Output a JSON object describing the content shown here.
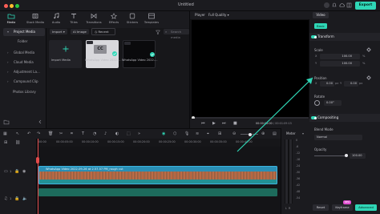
{
  "window": {
    "title": "Untitled",
    "export_label": "Export"
  },
  "toolbar": {
    "items": [
      {
        "label": "Media",
        "icon": "folder-icon"
      },
      {
        "label": "Stock Media",
        "icon": "stock-icon"
      },
      {
        "label": "Audio",
        "icon": "music-icon"
      },
      {
        "label": "Titles",
        "icon": "text-icon"
      },
      {
        "label": "Transitions",
        "icon": "transition-icon"
      },
      {
        "label": "Effects",
        "icon": "effects-icon"
      },
      {
        "label": "Stickers",
        "icon": "sticker-icon"
      },
      {
        "label": "Templates",
        "icon": "template-icon"
      }
    ]
  },
  "sidebar": {
    "items": [
      {
        "label": "Project Media"
      },
      {
        "label": "Folder"
      },
      {
        "label": "Global Media"
      },
      {
        "label": "Cloud Media"
      },
      {
        "label": "Adjustment La..."
      },
      {
        "label": "Compound Clip"
      },
      {
        "label": "Photos Library"
      }
    ]
  },
  "media": {
    "import_label": "Import",
    "ai_image_label": "AI Image",
    "recent_label": "Recent",
    "search_placeholder": "Search media",
    "import_tile_label": "Import Media",
    "clips": [
      {
        "label": "WhatsApp Video 2022-..."
      },
      {
        "label": "WhatsApp Video 2022-..."
      }
    ]
  },
  "player": {
    "label": "Player",
    "quality": "Full Quality",
    "time_current": "00:00:00:00",
    "time_total": "/ 00:01:09:15"
  },
  "inspector": {
    "tab_video": "Video",
    "sub_basic": "Basic",
    "transform": "Transform",
    "scale": "Scale",
    "scale_x_label": "X",
    "scale_x": "100.00",
    "scale_y_label": "Y",
    "scale_y": "100.00",
    "unit_pct": "%",
    "position": "Position",
    "pos_x_label": "X",
    "pos_x": "0.00",
    "pos_y_label": "Y",
    "pos_y": "0.00",
    "unit_px": "px",
    "rotate": "Rotate",
    "rotate_value": "0.00°",
    "compositing": "Compositing",
    "blend_mode": "Blend Mode",
    "blend_value": "Normal",
    "opacity": "Opacity",
    "opacity_value": "100.00",
    "reset_label": "Reset",
    "keyframe_label": "Keyframe",
    "keyframe_badge": "NEW",
    "advanced_label": "Advanced"
  },
  "timeline": {
    "ruler": [
      "00:00",
      "00:00:05:00",
      "00:00:10:00",
      "00:00:15:00",
      "00:00:20:00",
      "00:00:25:00",
      "00:00:30:00",
      "00:00:35:00",
      "00:00:40:00"
    ],
    "clip_title": "WhatsApp Video 2022-09-26 at 2.57.57 PM_rough cut",
    "track_video_index": "1",
    "track_audio_index": "1",
    "meter_label": "Meter",
    "meter_scale": [
      "0",
      "-6",
      "-12",
      "-18",
      "-24",
      "-30",
      "-36",
      "-42",
      "-48",
      "-54"
    ],
    "meter_lr": "L  R"
  },
  "colors": {
    "accent": "#2fd6b6",
    "playhead": "#e34b4b",
    "clip": "#2a8fb5"
  }
}
